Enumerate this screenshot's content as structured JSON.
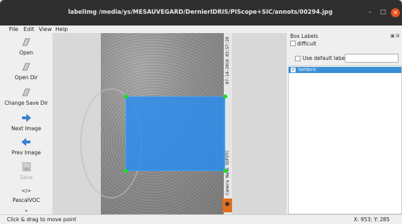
{
  "window": {
    "title": "labelImg /media/ys/MESAUVEGARD/DernierIDRIS/PIScope+SIC/annots/00294.jpg",
    "minimize_glyph": "–",
    "maximize_glyph": "□",
    "close_glyph": "✕"
  },
  "menu": {
    "file": "File",
    "edit": "Edit",
    "view": "View",
    "help": "Help"
  },
  "toolbar": {
    "open": "Open",
    "open_dir": "Open Dir",
    "change_save_dir": "Change Save Dir",
    "next_image": "Next Image",
    "prev_image": "Prev Image",
    "save": "Save",
    "format": "PascalVOC",
    "format_glyph": "</>",
    "more_glyph": "»"
  },
  "image": {
    "timestamp": "07-14-2016 03:57:20",
    "camera": "Camera Name  SOFOTC"
  },
  "dock": {
    "title": "Box Labels",
    "difficult": "difficult",
    "use_default_label": "Use default label",
    "default_label_value": "",
    "labels": [
      {
        "name": "lombric",
        "checked": true
      }
    ]
  },
  "status": {
    "message": "Click & drag to move point",
    "coords": "X: 953; Y: 285"
  },
  "colors": {
    "titlebar": "#2f2f2f",
    "close_button": "#e95420",
    "bbox_fill": "#288cf0",
    "handle": "#22dd22",
    "selection": "#3a8fd8"
  }
}
